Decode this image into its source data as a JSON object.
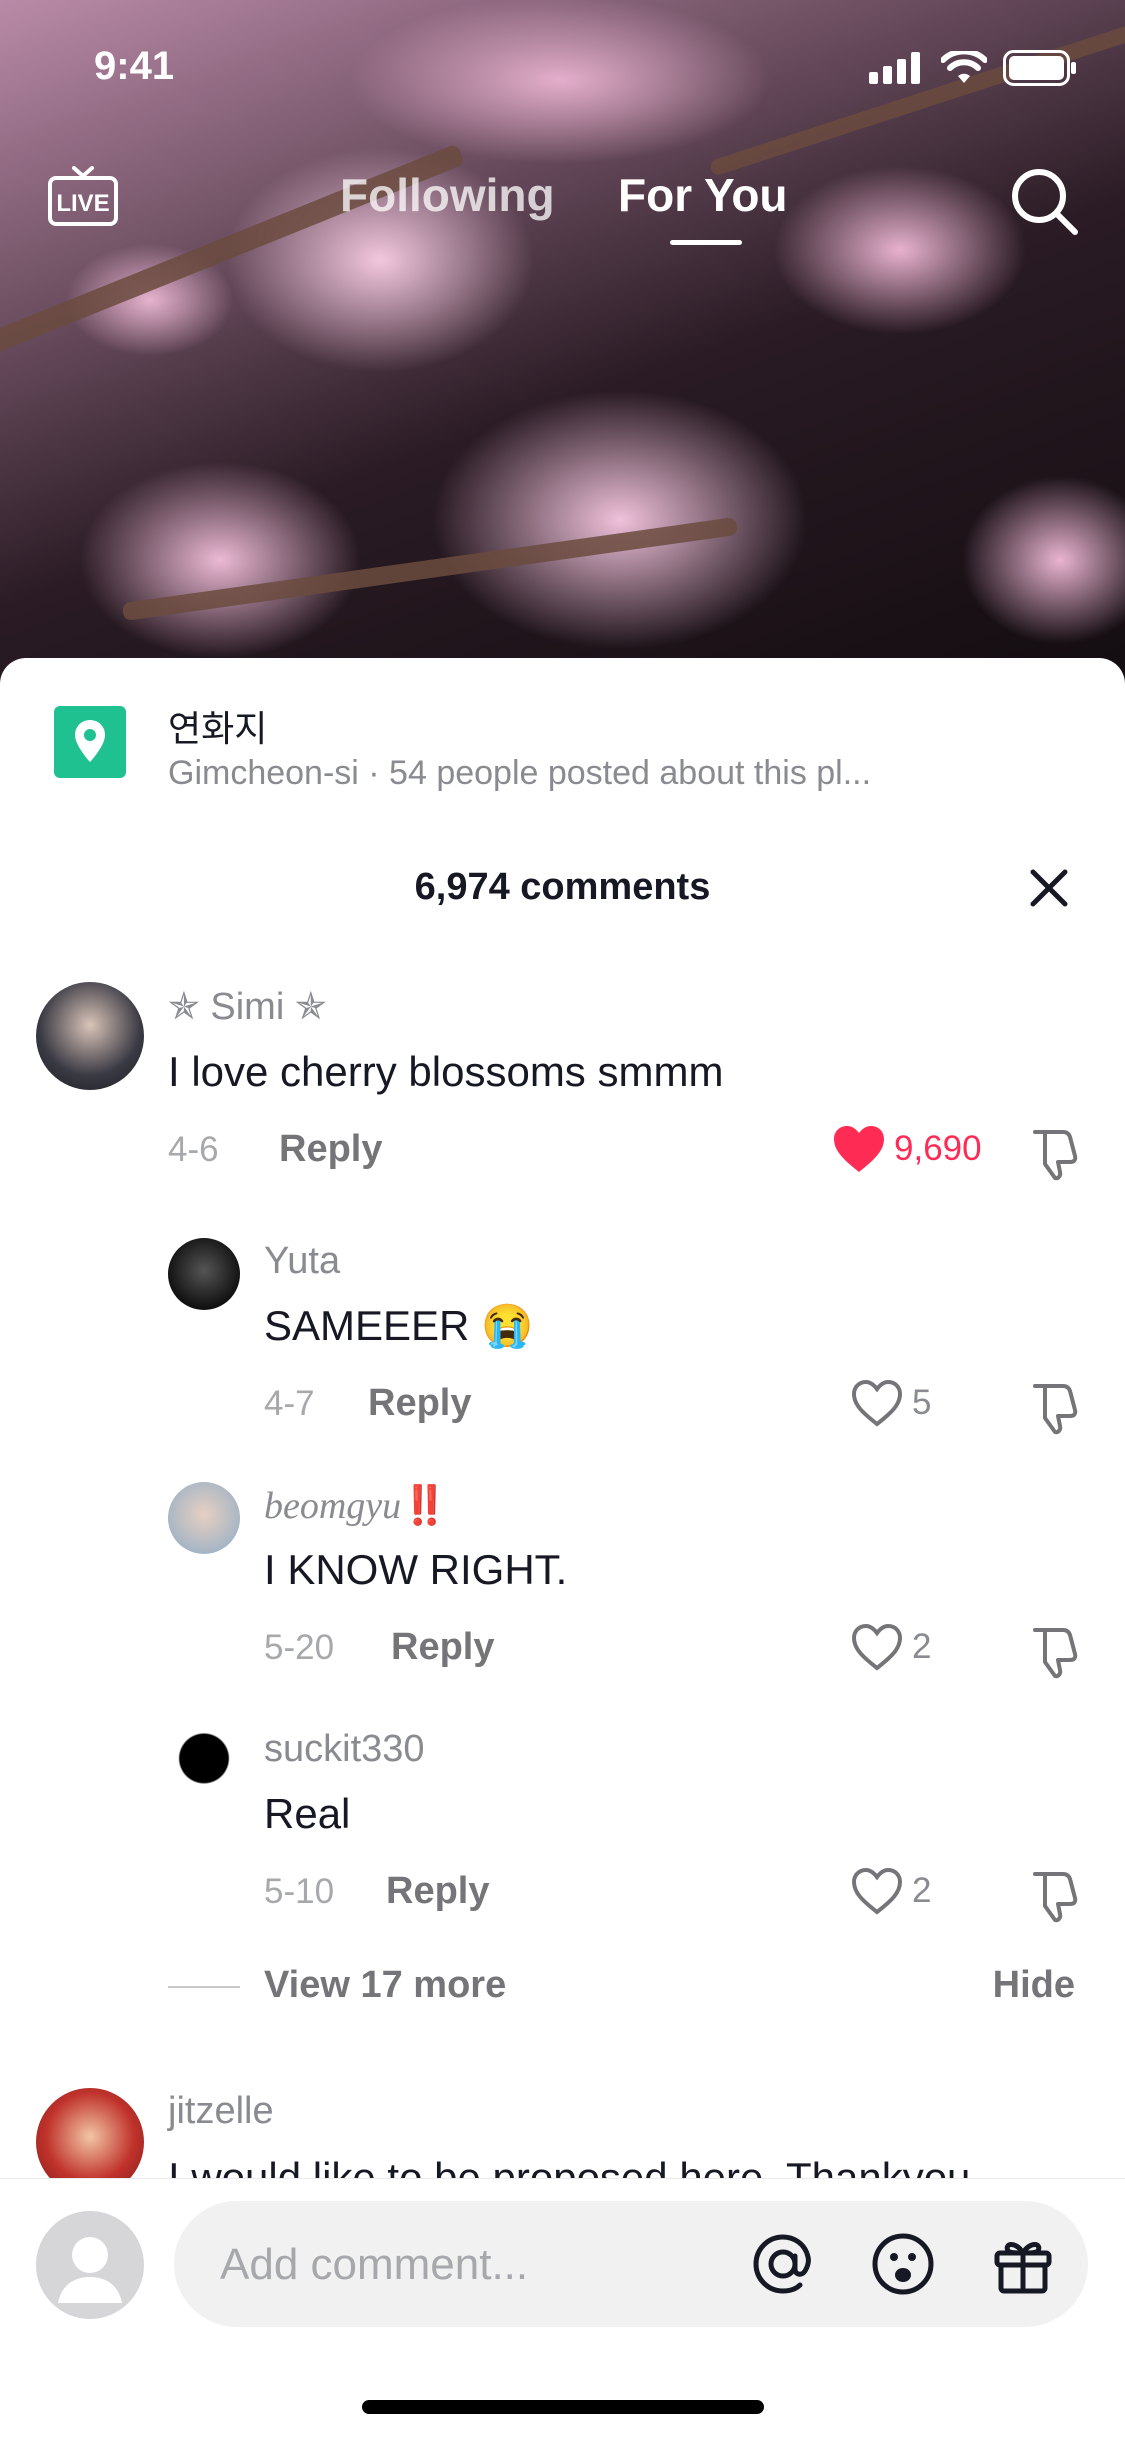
{
  "status_bar": {
    "time": "9:41"
  },
  "top_nav": {
    "live_label": "LIVE",
    "tabs": [
      {
        "label": "Following"
      },
      {
        "label": "For You"
      }
    ]
  },
  "location": {
    "name": "연화지",
    "subtitle": "Gimcheon-si · 54 people posted about this pl..."
  },
  "comments_header": {
    "count_text": "6,974 comments"
  },
  "comments": [
    {
      "name": "✯ Simi ✯",
      "text": "I love cherry blossoms smmm",
      "date": "4-6",
      "reply": "Reply",
      "likes": "9,690",
      "liked": true
    },
    {
      "name": "Yuta",
      "text": "SAMEEER 😭",
      "date": "4-7",
      "reply": "Reply",
      "likes": "5",
      "liked": false
    },
    {
      "name": "beomgyu",
      "name_suffix": "‼️",
      "text": "I KNOW RIGHT.",
      "date": "5-20",
      "reply": "Reply",
      "likes": "2",
      "liked": false
    },
    {
      "name": "suckit330",
      "text": "Real",
      "date": "5-10",
      "reply": "Reply",
      "likes": "2",
      "liked": false
    },
    {
      "name": "jitzelle",
      "text": "I would like to be proposed here. Thankyou"
    }
  ],
  "replies_toggle": {
    "view_more": "View 17 more",
    "hide": "Hide"
  },
  "composer": {
    "placeholder": "Add comment..."
  },
  "colors": {
    "accent": "#fe2c55",
    "location_badge": "#20c191",
    "text_primary": "#161823",
    "text_secondary": "#8a8b91"
  }
}
